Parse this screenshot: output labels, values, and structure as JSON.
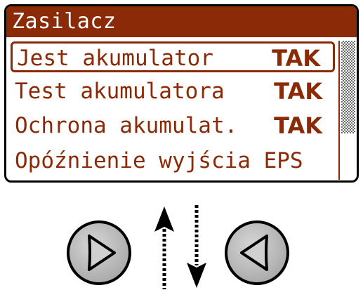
{
  "screen": {
    "title": "Zasilacz",
    "rows": [
      {
        "label": "Jest akumulator",
        "value": "TAK",
        "selected": true
      },
      {
        "label": "Test akumulatora",
        "value": "TAK",
        "selected": false
      },
      {
        "label": "Ochrona akumulat.",
        "value": "TAK",
        "selected": false
      },
      {
        "label": "Opóźnienie wyjścia EPS",
        "value": "",
        "selected": false
      }
    ]
  },
  "colors": {
    "lcd_accent": "#8b2a06",
    "button_fill": "#c0c0c0",
    "outline": "#000000"
  },
  "controls": {
    "right_button_icon": "triangle-right-icon",
    "left_button_icon": "triangle-left-icon",
    "scroll_up_icon": "arrow-up-icon",
    "scroll_down_icon": "arrow-down-icon"
  }
}
